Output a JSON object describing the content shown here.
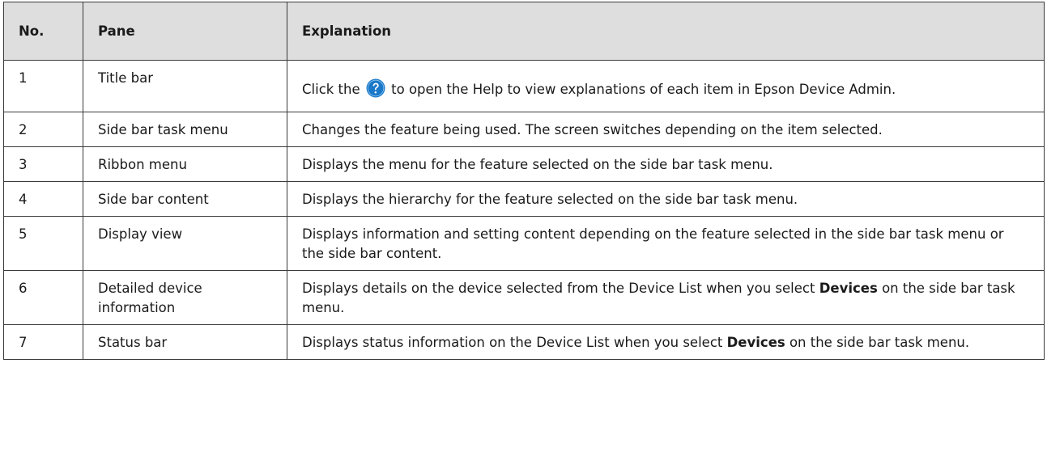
{
  "header": {
    "no": "No.",
    "pane": "Pane",
    "explanation": "Explanation"
  },
  "rows": [
    {
      "no": "1",
      "pane": "Title bar",
      "exp_before": "Click the",
      "exp_icon": "help-question-icon",
      "exp_after": "to open the Help to view explanations of each item in Epson Device Admin."
    },
    {
      "no": "2",
      "pane": "Side bar task menu",
      "explanation": "Changes the feature being used. The screen switches depending on the item selected."
    },
    {
      "no": "3",
      "pane": "Ribbon menu",
      "explanation": "Displays the menu for the feature selected on the side bar task menu."
    },
    {
      "no": "4",
      "pane": "Side bar content",
      "explanation": "Displays the hierarchy for the feature selected on the side bar task menu."
    },
    {
      "no": "5",
      "pane": "Display view",
      "explanation": "Displays information and setting content depending on the feature selected in the side bar task menu or the side bar content."
    },
    {
      "no": "6",
      "pane": "Detailed device information",
      "exp_before": "Displays details on the device selected from the Device List when you select",
      "exp_bold": "Devices",
      "exp_after": "on the side bar task menu."
    },
    {
      "no": "7",
      "pane": "Status bar",
      "exp_before": "Displays status information on the Device List when you select",
      "exp_bold": "Devices",
      "exp_after": "on the side bar task menu."
    }
  ],
  "colors": {
    "header_bg": "#dedede",
    "border": "#3a3a3a",
    "icon_blue": "#1a78c8"
  }
}
